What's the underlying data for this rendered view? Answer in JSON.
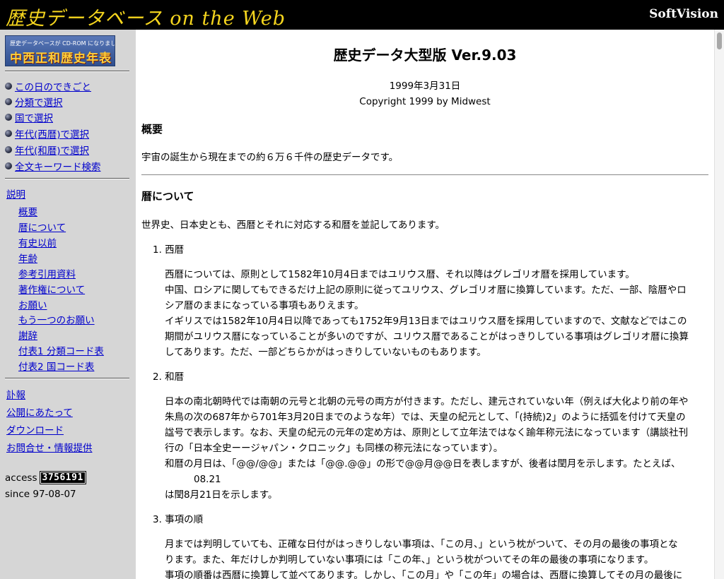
{
  "header": {
    "site_title": "歴史データベース on the Web",
    "brand": "SoftVision"
  },
  "sidebar": {
    "banner_top": "歴史データベースが CD-ROM になりました",
    "banner_main": "中西正和歴史年表",
    "nav": [
      "この日のできごと",
      "分類で選択",
      "国で選択",
      "年代(西暦)で選択",
      "年代(和暦)で選択",
      "全文キーワード検索"
    ],
    "desc_header": "説明",
    "desc_links": [
      "概要",
      "暦について",
      "有史以前",
      "年齢",
      "参考引用資料",
      "著作権について",
      "お願い",
      "もう一つのお願い",
      "謝辞",
      "付表1 分類コード表",
      "付表2 国コード表"
    ],
    "misc_links": [
      "訃報",
      "公開にあたって",
      "ダウンロード",
      "お問合せ・情報提供"
    ],
    "access_label": "access",
    "access_count": "3756191",
    "since": "since 97-08-07"
  },
  "main": {
    "title": "歴史データ大型版 Ver.9.03",
    "date": "1999年3月31日",
    "copyright": "Copyright 1999 by Midwest",
    "overview_heading": "概要",
    "overview_text": "宇宙の誕生から現在までの約６万６千件の歴史データです。",
    "calendar_heading": "暦について",
    "calendar_intro": "世界史、日本史とも、西暦とそれに対応する和暦を並記してあります。",
    "items": [
      {
        "heading": "1. 西暦",
        "lines": [
          "西暦については、原則として1582年10月4日まではユリウス暦、それ以降はグレゴリオ暦を採用しています。",
          "中国、ロシアに関してもできるだけ上記の原則に従ってユリウス、グレゴリオ暦に換算しています。ただ、一部、陰暦やロ",
          "シア暦のままになっている事項もありえます。",
          "イギリスでは1582年10月4日以降であっても1752年9月13日まではユリウス暦を採用していますので、文献などではこの",
          "期間がユリウス暦になっていることが多いのですが、ユリウス暦であることがはっきりしている事項はグレゴリオ暦に換算",
          "してあります。ただ、一部どちらかがはっきりしていないものもあります。"
        ]
      },
      {
        "heading": "2. 和暦",
        "lines": [
          "日本の南北朝時代では南朝の元号と北朝の元号の両方が付きます。ただし、建元されていない年（例えば大化より前の年や",
          "朱鳥の次の687年から701年3月20日までのような年）では、天皇の紀元として、「(持統)2」のように括弧を付けて天皇の",
          "諡号で表示します。なお、天皇の紀元の元年の定め方は、原則として立年法ではなく踰年称元法になっています（講談社刊",
          "行の「日本全史ーージャパン・クロニック」も同様の称元法になっています）。",
          "和暦の月日は、「@@/@@」または「@@.@@」の形で@@月@@日を表しますが、後者は閏月を示します。たとえば、",
          "08.21",
          "は閏8月21日を示します。"
        ]
      },
      {
        "heading": "3. 事項の順",
        "lines": [
          "月までは判明していても、正確な日付がはっきりしない事項は、「この月、」という枕がついて、その月の最後の事項とな",
          "ります。また、年だけしか判明していない事項には「この年、」という枕がついてその年の最後の事項になります。",
          "事項の順番は西暦に換算して並べてあります。しかし、「この月」や「この年」の場合は、西暦に換算してその月の最後に"
        ]
      }
    ]
  }
}
